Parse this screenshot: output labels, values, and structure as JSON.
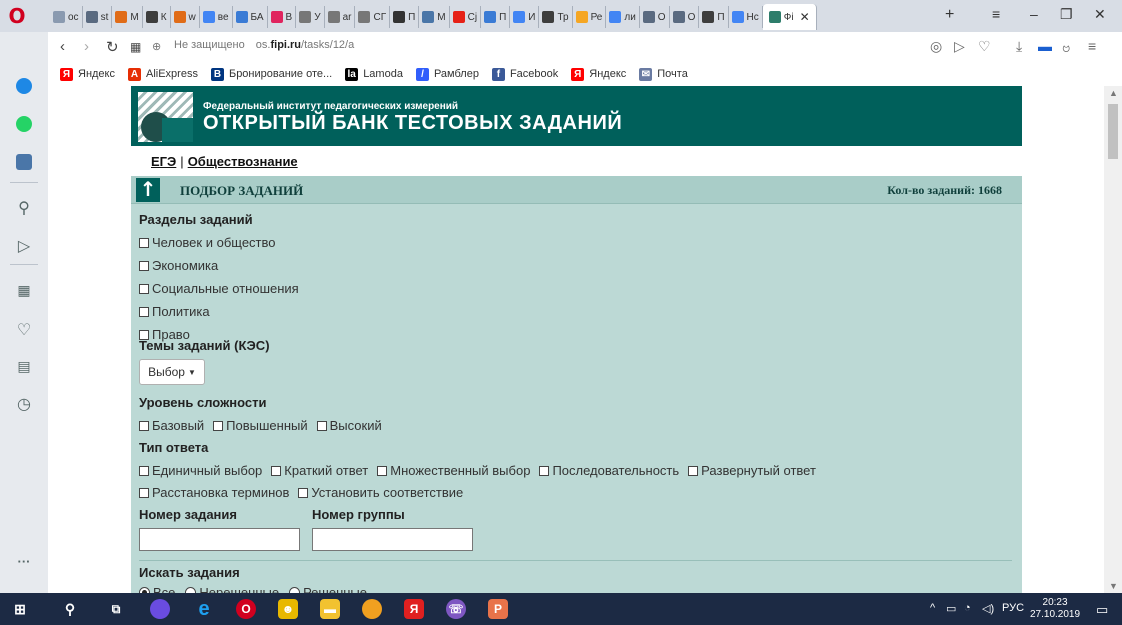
{
  "browser": {
    "tabs": [
      {
        "label": "ос",
        "color": "#8a9ab0"
      },
      {
        "label": "st",
        "color": "#5a6a80"
      },
      {
        "label": "М",
        "color": "#e06c18"
      },
      {
        "label": "К",
        "color": "#3d3d3d"
      },
      {
        "label": "w",
        "color": "#e06c18"
      },
      {
        "label": "ве",
        "color": "#4285f4"
      },
      {
        "label": "БА",
        "color": "#3a7bd5"
      },
      {
        "label": "В",
        "color": "#e0245e"
      },
      {
        "label": "У",
        "color": "#777777"
      },
      {
        "label": "ar",
        "color": "#777777"
      },
      {
        "label": "СГ",
        "color": "#777777"
      },
      {
        "label": "П",
        "color": "#333333"
      },
      {
        "label": "М",
        "color": "#4a76a8"
      },
      {
        "label": "Сј",
        "color": "#e62117"
      },
      {
        "label": "П",
        "color": "#3a7bd5"
      },
      {
        "label": "И",
        "color": "#4285f4"
      },
      {
        "label": "Тр",
        "color": "#3d3d3d"
      },
      {
        "label": "Ре",
        "color": "#f5a623"
      },
      {
        "label": "ли",
        "color": "#4285f4"
      },
      {
        "label": "О",
        "color": "#5a6a80"
      },
      {
        "label": "О",
        "color": "#5a6a80"
      },
      {
        "label": "П",
        "color": "#3d3d3d"
      },
      {
        "label": "Нс",
        "color": "#4285f4"
      }
    ],
    "active_tab": {
      "label": "Фі",
      "color": "#2e7d6b"
    },
    "address": {
      "security": "Не защищено",
      "domain_prefix": "os.",
      "domain": "fipi.ru",
      "path": "/tasks/12/a"
    },
    "bookmarks": [
      {
        "label": "Яндекс",
        "icon": "Я",
        "color": "#ff0000"
      },
      {
        "label": "AliExpress",
        "icon": "A",
        "color": "#e62e04"
      },
      {
        "label": "Бронирование оте...",
        "icon": "B",
        "color": "#003580"
      },
      {
        "label": "Lamoda",
        "icon": "la",
        "color": "#000000"
      },
      {
        "label": "Рамблер",
        "icon": "/",
        "color": "#315efb"
      },
      {
        "label": "Facebook",
        "icon": "f",
        "color": "#3b5998"
      },
      {
        "label": "Яндекс",
        "icon": "Я",
        "color": "#ff0000"
      },
      {
        "label": "Почта",
        "icon": "✉",
        "color": "#6a7ba2"
      }
    ]
  },
  "site": {
    "institute": "Федеральный институт педагогических измерений",
    "bank_title": "ОТКРЫТЫЙ БАНК ТЕСТОВЫХ ЗАДАНИЙ",
    "crumb_exam": "ЕГЭ",
    "crumb_sep": "|",
    "crumb_subject": "Обществознание",
    "panel_title": "ПОДБОР ЗАДАНИЙ",
    "panel_count": "Кол-во заданий: 1668",
    "accent": "#00605b",
    "panel_bg": "#bcd9d5"
  },
  "form": {
    "sections_label": "Разделы заданий",
    "sections": [
      "Человек и общество",
      "Экономика",
      "Социальные отношения",
      "Политика",
      "Право"
    ],
    "themes_label": "Темы заданий (КЭС)",
    "select_button": "Выбор",
    "level_label": "Уровень сложности",
    "levels": [
      "Базовый",
      "Повышенный",
      "Высокий"
    ],
    "answer_label": "Тип ответа",
    "answer_types_row1": [
      "Единичный выбор",
      "Краткий ответ",
      "Множественный выбор",
      "Последовательность",
      "Развернутый ответ"
    ],
    "answer_types_row2": [
      "Расстановка терминов",
      "Установить соответствие"
    ],
    "task_number_label": "Номер задания",
    "group_number_label": "Номер группы",
    "search_label": "Искать задания",
    "search_options": [
      {
        "label": "Все",
        "selected": true
      },
      {
        "label": "Нерешенные",
        "selected": false
      },
      {
        "label": "Решенные",
        "selected": false
      }
    ]
  },
  "taskbar": {
    "lang": "РУС",
    "time": "20:23",
    "date": "27.10.2019"
  }
}
